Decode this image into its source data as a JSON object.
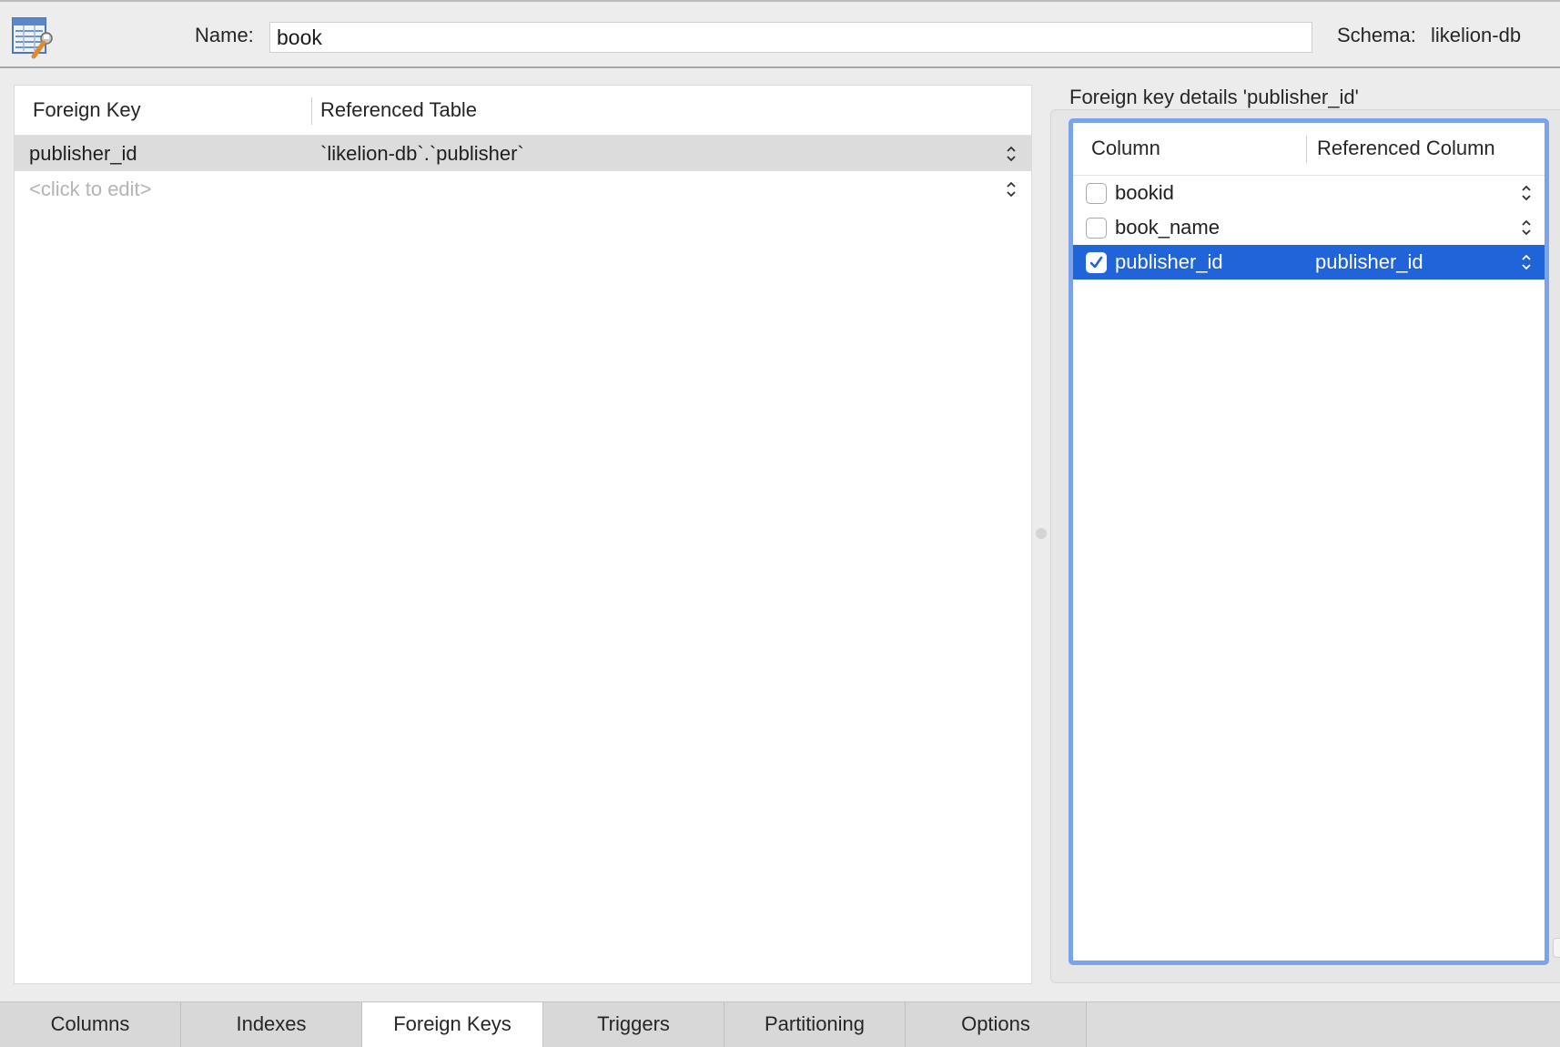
{
  "header": {
    "name_label": "Name:",
    "name_value": "book",
    "schema_label": "Schema:",
    "schema_value": "likelion-db"
  },
  "foreign_keys": {
    "columns": [
      "Foreign Key",
      "Referenced Table"
    ],
    "rows": [
      {
        "name": "publisher_id",
        "referenced_table": "`likelion-db`.`publisher`",
        "selected": true
      }
    ],
    "placeholder": "<click to edit>"
  },
  "details": {
    "title": "Foreign key details 'publisher_id'",
    "columns": [
      "Column",
      "Referenced Column"
    ],
    "rows": [
      {
        "column": "bookid",
        "referenced": "",
        "checked": false,
        "selected": false
      },
      {
        "column": "book_name",
        "referenced": "",
        "checked": false,
        "selected": false
      },
      {
        "column": "publisher_id",
        "referenced": "publisher_id",
        "checked": true,
        "selected": true
      }
    ]
  },
  "tabs": [
    {
      "label": "Columns",
      "active": false
    },
    {
      "label": "Indexes",
      "active": false
    },
    {
      "label": "Foreign Keys",
      "active": true
    },
    {
      "label": "Triggers",
      "active": false
    },
    {
      "label": "Partitioning",
      "active": false
    },
    {
      "label": "Options",
      "active": false
    }
  ],
  "colors": {
    "selection_blue": "#2164da",
    "focus_ring": "#7aa3ec",
    "selected_row_gray": "#dcdcdc"
  },
  "icons": {
    "table": "table-editor-icon",
    "stepper": "up-down-stepper-icon",
    "checkmark": "checkmark-icon"
  }
}
